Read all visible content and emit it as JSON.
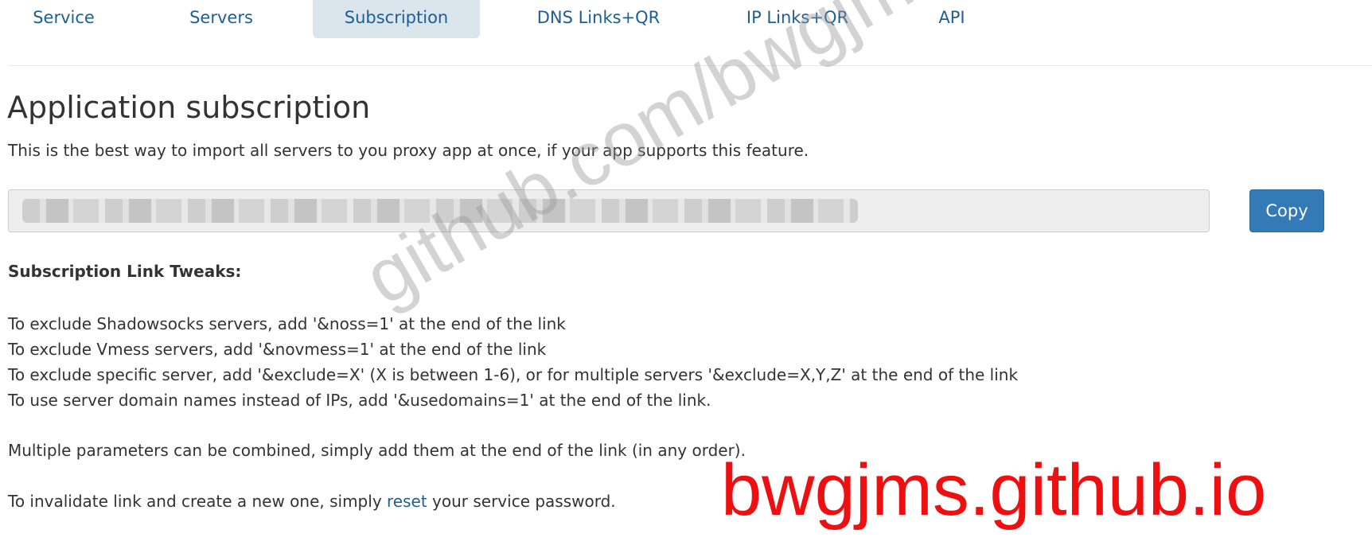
{
  "nav": {
    "tabs": [
      {
        "label": "Service",
        "active": false
      },
      {
        "label": "Servers",
        "active": false
      },
      {
        "label": "Subscription",
        "active": true
      },
      {
        "label": "DNS Links+QR",
        "active": false
      },
      {
        "label": "IP Links+QR",
        "active": false
      },
      {
        "label": "API",
        "active": false
      }
    ]
  },
  "main": {
    "title": "Application subscription",
    "intro": "This is the best way to import all servers to you proxy app at once, if your app supports this feature.",
    "subscription_link": {
      "value": ""
    },
    "copy_label": "Copy",
    "tweaks_heading": "Subscription Link Tweaks:",
    "tweaks": [
      "To exclude Shadowsocks servers, add '&noss=1' at the end of the link",
      "To exclude Vmess servers, add '&novmess=1' at the end of the link",
      "To exclude specific server, add '&exclude=X' (X is between 1-6), or for multiple servers '&exclude=X,Y,Z' at the end of the link",
      "To use server domain names instead of IPs, add '&usedomains=1' at the end of the link."
    ],
    "combine_note": "Multiple parameters can be combined, simply add them at the end of the link (in any order).",
    "invalidate": {
      "before": "To invalidate link and create a new one, simply ",
      "link": "reset",
      "after": " your service password."
    }
  },
  "watermarks": {
    "diagonal": "github.com/bwgjms",
    "red": "bwgjms.github.io"
  },
  "colors": {
    "link": "#1f5e92",
    "active_tab_bg": "#dbe5ec",
    "button_bg": "#337ab7",
    "watermark_red": "#ee1010"
  }
}
